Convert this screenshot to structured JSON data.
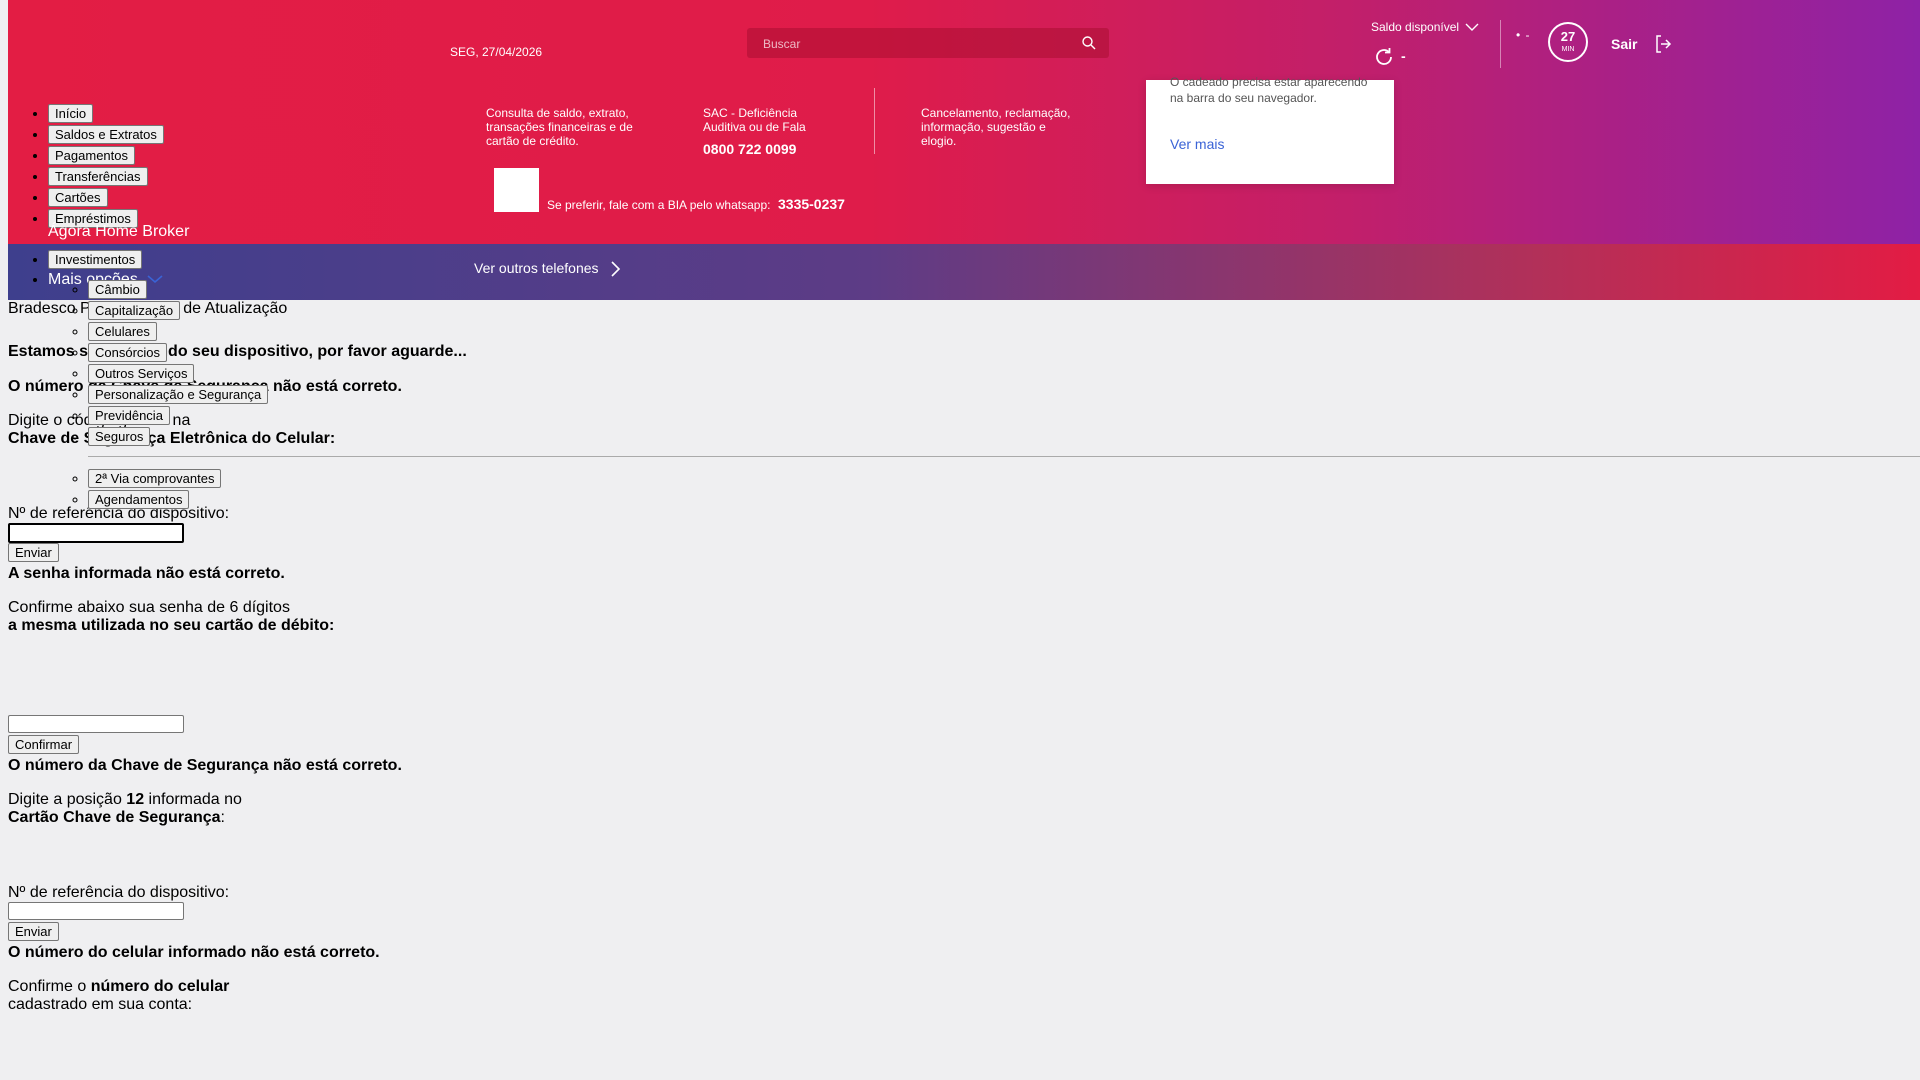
{
  "header": {
    "date": "SEG, 27/04/2026",
    "search_placeholder": "Buscar",
    "balance_label": "Saldo disponível",
    "balance_value": "-",
    "dots": "• -",
    "timer_value": "27",
    "timer_unit": "MIN",
    "logout_label": "Sair"
  },
  "contacts": {
    "col1": "Consulta de saldo, extrato, transações financeiras e de cartão de crédito.",
    "col2_label": "SAC - Deficiência Auditiva ou de Fala",
    "col2_phone": "0800 722 0099",
    "col3": "Cancelamento, reclamação, informação, sugestão e elogio.",
    "whats_text": "Se preferir, fale com a BIA pelo whatsapp:",
    "whats_number": "3335-0237",
    "other_phones": "Ver outros telefones"
  },
  "lock_card": {
    "text": "O cadeado precisa estar aparecendo na barra do seu navegador.",
    "more": "Ver mais"
  },
  "nav": {
    "items": [
      "Início",
      "Saldos e Extratos",
      "Pagamentos",
      "Transferências",
      "Cartões",
      "Empréstimos"
    ],
    "link": "Ágora Home Broker",
    "investments": "Investimentos",
    "more_options": "Mais opções",
    "sub_items": [
      "Câmbio",
      "Capitalização",
      "Celulares",
      "Consórcios",
      "Outros Serviços",
      "Personalização e Segurança",
      "Previdência",
      "Seguros"
    ],
    "sub_items_2": [
      "2ª Via comprovantes",
      "Agendamentos"
    ]
  },
  "main": {
    "title": "Bradesco Procedimento de Atualização",
    "loading": "Estamos sincronizando seu dispositivo, por favor aguarde...",
    "err_key": "O número da Chave de Segurança não está correto.",
    "prompt_app_1": "Digite o código gerado na",
    "prompt_app_2": "Chave de Segurança Eletrônica do Celular:",
    "ref_label": "Nº de referência do dispositivo:",
    "send": "Enviar",
    "err_password": "A senha informada não está correto.",
    "confirm_pwd_1": "Confirme abaixo sua senha de 6 dígitos",
    "confirm_pwd_2": "a mesma utilizada no seu cartão de débito:",
    "confirm": "Confirmar",
    "err_key_2": "O número da Chave de Segurança não está correto.",
    "pos_prefix": "Digite a posição",
    "pos_number": "12",
    "pos_suffix": "informada no",
    "card_name": "Cartão Chave de Segurança",
    "colon": ":",
    "ref_label_2": "Nº de referência do dispositivo:",
    "send_2": "Enviar",
    "err_phone": "O número do celular informado não está correto.",
    "confirm_phone_prefix": "Confirme o",
    "confirm_phone_bold": "número do celular",
    "confirm_phone_suffix": "cadastrado em sua conta:"
  }
}
